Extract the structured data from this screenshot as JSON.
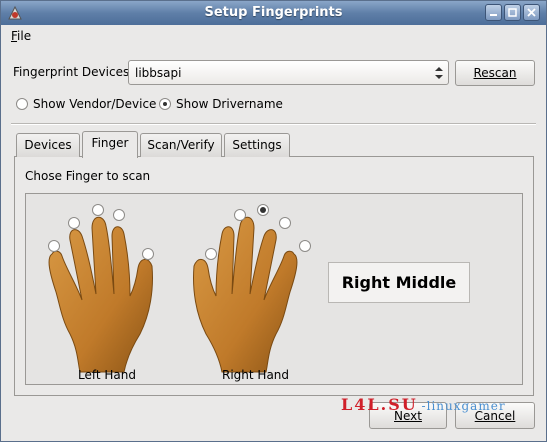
{
  "window": {
    "title": "Setup Fingerprints"
  },
  "menu": {
    "file_label": "File",
    "file_mnemonic": "F",
    "file_rest": "ile"
  },
  "devices": {
    "label": "Fingerprint Devices:",
    "selected": "libbsapi",
    "rescan_label": "Rescan"
  },
  "display_options": [
    {
      "label": "Show Vendor/Device",
      "selected": false
    },
    {
      "label": "Show Drivername",
      "selected": true
    }
  ],
  "tabs": [
    {
      "label": "Devices",
      "active": false
    },
    {
      "label": "Finger",
      "active": true
    },
    {
      "label": "Scan/Verify",
      "active": false
    },
    {
      "label": "Settings",
      "active": false
    }
  ],
  "finger_tab": {
    "instruction": "Chose Finger to scan",
    "left_hand_label": "Left Hand",
    "right_hand_label": "Right Hand",
    "selected_finger": "Right Middle",
    "left_hand_selected": [
      false,
      false,
      false,
      false,
      false
    ],
    "right_hand_selected": [
      false,
      false,
      true,
      false,
      false
    ]
  },
  "footer": {
    "next_label": "Next",
    "cancel_label": "Cancel"
  },
  "watermark": {
    "text": "L4L.SU",
    "suffix": "-linuxgamer"
  },
  "colors": {
    "skin": "#c5832d",
    "skin_dark": "#7a4a12",
    "title_bar": "#5f7fa8"
  }
}
